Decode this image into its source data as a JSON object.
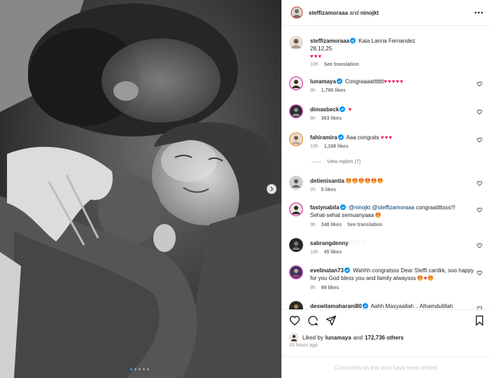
{
  "header": {
    "username": "steffizamoraaa",
    "joiner": "and",
    "collaborator": "ninojkt"
  },
  "caption": {
    "username": "steffizamoraaa",
    "line1": "Kaia Lanna Fernandez",
    "line2": "28,12,25",
    "hearts": "♥♥♥",
    "time": "10h",
    "see_translation": "See translation"
  },
  "comments": [
    {
      "username": "lunamaya",
      "verified": true,
      "text": "Congraaaattttttt",
      "emoji": "♥♥♥♥♥",
      "time": "9h",
      "likes": "1,766 likes"
    },
    {
      "username": "dimasbeck",
      "verified": true,
      "text": "",
      "emoji": "♥",
      "time": "8h",
      "likes": "363 likes"
    },
    {
      "username": "fahiramira",
      "verified": true,
      "text": "Aaa congrats",
      "emoji": "♥♥♥",
      "time": "10h",
      "likes": "1,168 likes"
    },
    {
      "username": "detienisantia",
      "verified": false,
      "text": "",
      "emoji": "",
      "time": "2h",
      "likes": "5 likes"
    },
    {
      "username": "fastynabila",
      "verified": true,
      "mention1": "@ninojkt",
      "mention2": "@steffizamoraaa",
      "text": "congraattttsss!!!",
      "text2": "Sehat-sehat semuanyaaa",
      "time": "9h",
      "likes": "348 likes",
      "see_translation": "See translation"
    },
    {
      "username": "sabrangdenny",
      "verified": false,
      "text": "",
      "emoji": "♡♡♡",
      "time": "10h",
      "likes": "45 likes"
    },
    {
      "username": "evelinatan73",
      "verified": true,
      "text": "Wahhh congratsss Dear Steffi cantkk, soo happy for you God bless you and family alwaysss",
      "time": "9h",
      "likes": "98 likes"
    },
    {
      "username": "deswitamaharani80",
      "verified": true,
      "text": "Aahh Masyaallah .. Alhamdulillah"
    }
  ],
  "view_replies": "View replies (7)",
  "liked_by": {
    "prefix": "Liked by",
    "user": "lunamaya",
    "joiner": "and",
    "others": "172,736 others"
  },
  "time_ago": "10 hours ago",
  "limited_notice": "Comments on this post have been limited.",
  "carousel": {
    "total": 5,
    "active": 1
  },
  "colors": {
    "verified": "#0095f6",
    "heart": "#ed1d62",
    "muted": "#8e8e8e"
  }
}
